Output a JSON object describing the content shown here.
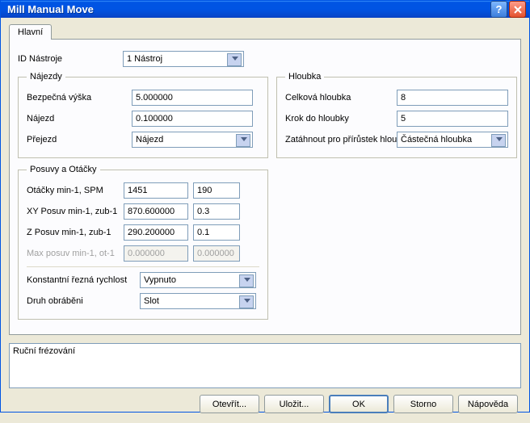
{
  "window": {
    "title": "Mill Manual Move"
  },
  "tabs": {
    "main": "Hlavní"
  },
  "toolId": {
    "label": "ID Nástroje",
    "value": "1 Nástroj"
  },
  "najezdy": {
    "legend": "Nájezdy",
    "safeHeight": {
      "label": "Bezpečná výška",
      "value": "5.000000"
    },
    "approach": {
      "label": "Nájezd",
      "value": "0.100000"
    },
    "travel": {
      "label": "Přejezd",
      "value": "Nájezd"
    }
  },
  "hloubka": {
    "legend": "Hloubka",
    "total": {
      "label": "Celková hloubka",
      "value": "8"
    },
    "step": {
      "label": "Krok do hloubky",
      "value": "5"
    },
    "retract": {
      "label": "Zatáhnout pro přírůstek hloub",
      "value": "Částečná hloubka"
    }
  },
  "posuvy": {
    "legend": "Posuvy a Otáčky",
    "spm": {
      "label": "Otáčky min-1, SPM",
      "v1": "1451",
      "v2": "190"
    },
    "xy": {
      "label": "XY Posuv min-1, zub-1",
      "v1": "870.600000",
      "v2": "0.3"
    },
    "z": {
      "label": "Z Posuv min-1, zub-1",
      "v1": "290.200000",
      "v2": "0.1"
    },
    "max": {
      "label": "Max posuv min-1, ot-1",
      "v1": "0.000000",
      "v2": "0.000000"
    },
    "constSpeed": {
      "label": "Konstantní řezná rychlost",
      "value": "Vypnuto"
    },
    "machType": {
      "label": "Druh obráběni",
      "value": "Slot"
    }
  },
  "note": "Ruční frézování",
  "buttons": {
    "open": "Otevřít...",
    "save": "Uložit...",
    "ok": "OK",
    "cancel": "Storno",
    "help": "Nápověda"
  }
}
